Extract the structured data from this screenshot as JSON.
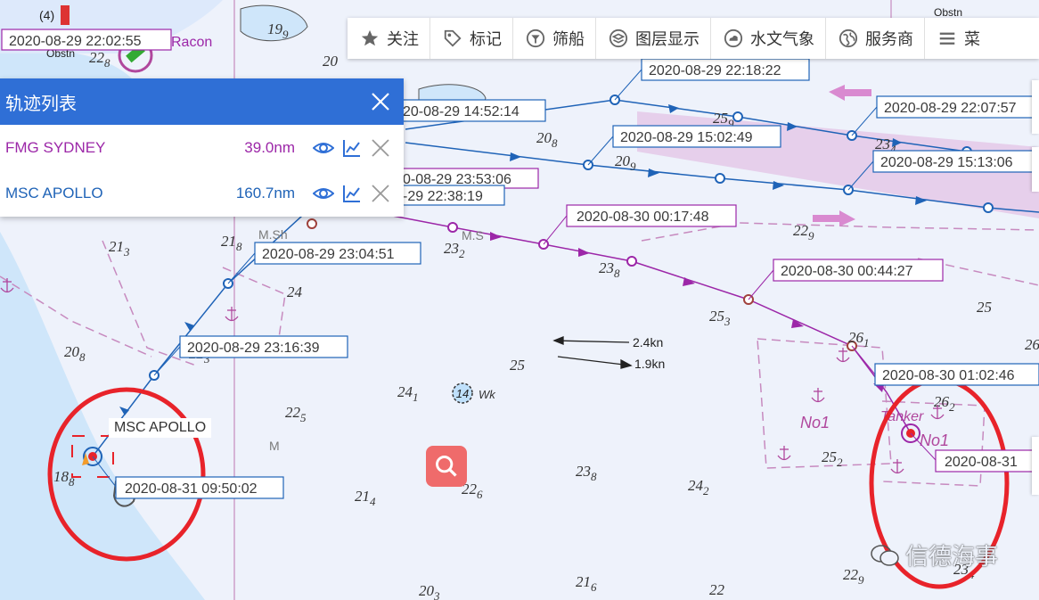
{
  "toolbar": {
    "items": [
      {
        "label": "关注",
        "icon": "star-icon"
      },
      {
        "label": "标记",
        "icon": "tag-icon"
      },
      {
        "label": "筛船",
        "icon": "filter-icon"
      },
      {
        "label": "图层显示",
        "icon": "layers-icon"
      },
      {
        "label": "水文气象",
        "icon": "weather-icon"
      },
      {
        "label": "服务商",
        "icon": "globe-icon"
      },
      {
        "label": "菜",
        "icon": "menu-icon"
      }
    ]
  },
  "track_panel": {
    "title": "轨迹列表",
    "tracks": [
      {
        "name": "FMG SYDNEY",
        "distance": "39.0nm",
        "color": "#9c27a8"
      },
      {
        "name": "MSC APOLLO",
        "distance": "160.7nm",
        "color": "#1f63b7"
      }
    ]
  },
  "map": {
    "ship_label": "MSC APOLLO",
    "timestamps": {
      "t1": "2020-08-29 22:02:55",
      "t2": "2020-08-29 22:18:22",
      "t3": "20-08-29 14:52:14",
      "t4": "2020-08-29 22:07:57",
      "t5": "2020-08-29 15:02:49",
      "t6": "2020-08-29 15:13:06",
      "t7": "0-08-29 23:53:06",
      "t8": "-29 22:38:19",
      "t9": "2020-08-30 00:17:48",
      "t10": "2020-08-29 23:04:51",
      "t11": "2020-08-30 00:44:27",
      "t12": "2020-08-29 23:16:39",
      "t13": "2020-08-30 01:02:46",
      "t14": "2020-08-31",
      "t15": "2020-08-31 09:50:02"
    },
    "labels": {
      "racon": "Racon",
      "msh": "M.Sh",
      "ms": "M.S",
      "m": "M",
      "wk": "Wk",
      "tanker": "Tanker",
      "no1_a": "No1",
      "no1_b": "No1",
      "speed1": "2.4kn",
      "speed2": "1.9kn",
      "wreck_num": "14",
      "top_left_num": "(4)",
      "obstn": "Obstn",
      "obstn2": "Obstn"
    },
    "depths": [
      {
        "text": "19",
        "sub": "9"
      },
      {
        "text": "20",
        "sub": ""
      },
      {
        "text": "20",
        "sub": "8"
      },
      {
        "text": "20",
        "sub": "9"
      },
      {
        "text": "25",
        "sub": "9"
      },
      {
        "text": "23",
        "sub": "4"
      },
      {
        "text": "22",
        "sub": "9"
      },
      {
        "text": "21",
        "sub": "3"
      },
      {
        "text": "21",
        "sub": "8"
      },
      {
        "text": "23",
        "sub": "2"
      },
      {
        "text": "23",
        "sub": "8"
      },
      {
        "text": "24",
        "sub": ""
      },
      {
        "text": "25",
        "sub": "3"
      },
      {
        "text": "26",
        "sub": "1"
      },
      {
        "text": "20",
        "sub": "8"
      },
      {
        "text": "22",
        "sub": "3"
      },
      {
        "text": "24",
        "sub": "1"
      },
      {
        "text": "25",
        "sub": ""
      },
      {
        "text": "22",
        "sub": "5"
      },
      {
        "text": "26",
        "sub": "2"
      },
      {
        "text": "25",
        "sub": "2"
      },
      {
        "text": "23",
        "sub": "8"
      },
      {
        "text": "24",
        "sub": "2"
      },
      {
        "text": "21",
        "sub": "4"
      },
      {
        "text": "22",
        "sub": "6"
      },
      {
        "text": "21",
        "sub": "6"
      },
      {
        "text": "20",
        "sub": "3"
      },
      {
        "text": "22",
        "sub": ""
      },
      {
        "text": "22",
        "sub": "9"
      },
      {
        "text": "23",
        "sub": "4"
      },
      {
        "text": "22",
        "sub": "0"
      },
      {
        "text": "26",
        "sub": ""
      },
      {
        "text": "22",
        "sub": "8"
      },
      {
        "text": "18",
        "sub": "8"
      },
      {
        "text": "25",
        "sub": ""
      }
    ]
  },
  "watermark": "信德海事",
  "colors": {
    "blue_track": "#1f63b7",
    "purple_track": "#9c27a8",
    "panel_header": "#2f6fd6",
    "highlight_circle": "#e8232a"
  }
}
